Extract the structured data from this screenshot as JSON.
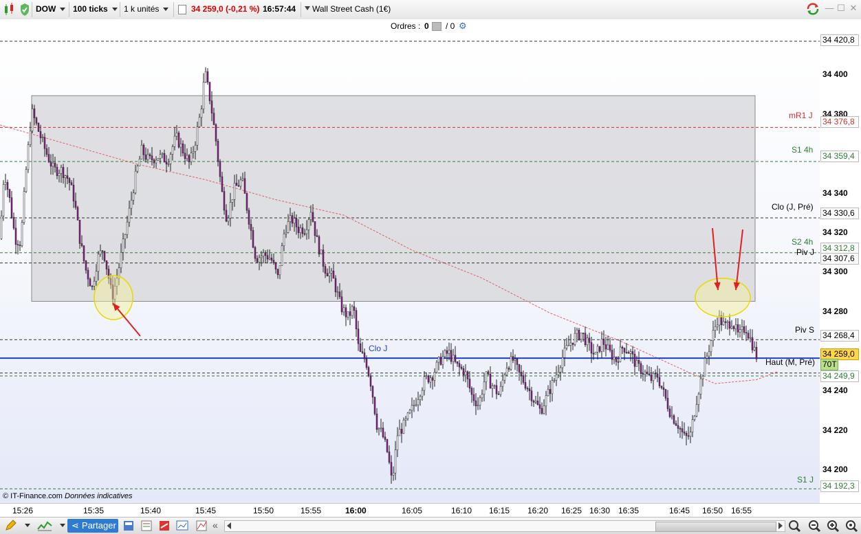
{
  "toolbar": {
    "symbol": "DOW",
    "ticks": "100 ticks",
    "units": "1 k unités",
    "price": "34 259,0",
    "change": "(-0,21 %)",
    "time": "16:57:44",
    "instrument": "Wall Street Cash (1€)"
  },
  "orders": {
    "label": "Ordres :",
    "count": "0",
    "sep": "/ 0"
  },
  "yaxis": {
    "ticks": [
      "34 400",
      "34 380",
      "34 340",
      "34 320",
      "34 300",
      "34 280",
      "34 240",
      "34 220",
      "34 200"
    ],
    "levels": [
      {
        "value": "34 420,8",
        "color": "#000000"
      },
      {
        "value": "34 376,8",
        "color": "#c83232"
      },
      {
        "value": "34 359,4",
        "color": "#2e7d32"
      },
      {
        "value": "34 330,6",
        "color": "#000000"
      },
      {
        "value": "34 312,8",
        "color": "#2e7d32"
      },
      {
        "value": "34 307,6",
        "color": "#000000"
      },
      {
        "value": "34 268,4",
        "color": "#000000"
      },
      {
        "value": "34 259,0",
        "color": "#000000"
      },
      {
        "value": "70T",
        "color": "#000000"
      },
      {
        "value": "34 249,9",
        "color": "#2e7d32"
      },
      {
        "value": "34 192,3",
        "color": "#2e7d32"
      }
    ]
  },
  "line_labels": {
    "mr1j": "mR1 J",
    "s14h": "S1 4h",
    "cloj_pre": "Clo (J, Pré)",
    "s24h": "S2 4h",
    "pivj": "Piv J",
    "pivs": "Piv S",
    "cloj": "Clo J",
    "haut": "Haut (M, Pré)",
    "s1j": "S1 J"
  },
  "xaxis": {
    "labels": [
      "15:26",
      "15:35",
      "15:40",
      "15:45",
      "15:50",
      "15:55",
      "16:00",
      "16:05",
      "16:10",
      "16:15",
      "16:20",
      "16:25",
      "16:30",
      "16:35",
      "16:45",
      "16:50",
      "16:55"
    ]
  },
  "footer": {
    "copyright": "© IT-Finance.com",
    "note": "Données indicatives"
  },
  "bottombar": {
    "share_label": "Partager"
  },
  "colors": {
    "candle_body": "#8b1a8b",
    "candle_wick": "#222222",
    "price_line": "#1f3fc9",
    "zone": "#d6d6da",
    "highlight_circle": "#f3ef9a",
    "arrow": "#e02020",
    "current_price_bg": "#ffd54a",
    "tick_count_bg": "#b6e08a"
  },
  "chart_data": {
    "type": "candlestick",
    "instrument": "Wall Street Cash (1€)",
    "interval": "100 ticks",
    "ylim": [
      34185,
      34425
    ],
    "last": 34259.0,
    "path": [
      [
        0,
        34320
      ],
      [
        6,
        34355
      ],
      [
        14,
        34340
      ],
      [
        22,
        34320
      ],
      [
        30,
        34318
      ],
      [
        38,
        34355
      ],
      [
        46,
        34385
      ],
      [
        56,
        34375
      ],
      [
        66,
        34365
      ],
      [
        78,
        34355
      ],
      [
        90,
        34355
      ],
      [
        100,
        34350
      ],
      [
        108,
        34340
      ],
      [
        116,
        34320
      ],
      [
        124,
        34305
      ],
      [
        134,
        34295
      ],
      [
        142,
        34310
      ],
      [
        150,
        34315
      ],
      [
        158,
        34300
      ],
      [
        163,
        34290
      ],
      [
        170,
        34300
      ],
      [
        178,
        34315
      ],
      [
        186,
        34330
      ],
      [
        196,
        34350
      ],
      [
        206,
        34365
      ],
      [
        216,
        34360
      ],
      [
        230,
        34362
      ],
      [
        244,
        34360
      ],
      [
        256,
        34372
      ],
      [
        266,
        34365
      ],
      [
        276,
        34358
      ],
      [
        284,
        34370
      ],
      [
        292,
        34385
      ],
      [
        298,
        34405
      ],
      [
        306,
        34390
      ],
      [
        314,
        34370
      ],
      [
        322,
        34345
      ],
      [
        330,
        34330
      ],
      [
        340,
        34345
      ],
      [
        352,
        34350
      ],
      [
        362,
        34330
      ],
      [
        372,
        34310
      ],
      [
        384,
        34312
      ],
      [
        394,
        34310
      ],
      [
        404,
        34300
      ],
      [
        414,
        34325
      ],
      [
        424,
        34330
      ],
      [
        434,
        34325
      ],
      [
        444,
        34325
      ],
      [
        452,
        34335
      ],
      [
        460,
        34320
      ],
      [
        472,
        34305
      ],
      [
        484,
        34300
      ],
      [
        496,
        34285
      ],
      [
        506,
        34280
      ],
      [
        514,
        34285
      ],
      [
        522,
        34262
      ],
      [
        532,
        34258
      ],
      [
        540,
        34245
      ],
      [
        548,
        34225
      ],
      [
        556,
        34220
      ],
      [
        564,
        34210
      ],
      [
        570,
        34195
      ],
      [
        578,
        34220
      ],
      [
        588,
        34225
      ],
      [
        598,
        34232
      ],
      [
        608,
        34240
      ],
      [
        618,
        34248
      ],
      [
        628,
        34250
      ],
      [
        640,
        34258
      ],
      [
        652,
        34262
      ],
      [
        664,
        34255
      ],
      [
        676,
        34252
      ],
      [
        686,
        34240
      ],
      [
        696,
        34235
      ],
      [
        706,
        34250
      ],
      [
        716,
        34245
      ],
      [
        726,
        34240
      ],
      [
        736,
        34255
      ],
      [
        746,
        34258
      ],
      [
        756,
        34250
      ],
      [
        766,
        34245
      ],
      [
        776,
        34238
      ],
      [
        786,
        34232
      ],
      [
        796,
        34240
      ],
      [
        806,
        34248
      ],
      [
        816,
        34258
      ],
      [
        826,
        34265
      ],
      [
        836,
        34270
      ],
      [
        846,
        34272
      ],
      [
        856,
        34265
      ],
      [
        866,
        34260
      ],
      [
        876,
        34268
      ],
      [
        886,
        34262
      ],
      [
        896,
        34258
      ],
      [
        906,
        34265
      ],
      [
        916,
        34262
      ],
      [
        926,
        34255
      ],
      [
        936,
        34252
      ],
      [
        946,
        34248
      ],
      [
        956,
        34250
      ],
      [
        966,
        34240
      ],
      [
        976,
        34230
      ],
      [
        986,
        34225
      ],
      [
        996,
        34218
      ],
      [
        1004,
        34220
      ],
      [
        1014,
        34240
      ],
      [
        1024,
        34255
      ],
      [
        1034,
        34268
      ],
      [
        1044,
        34280
      ],
      [
        1054,
        34275
      ],
      [
        1064,
        34278
      ],
      [
        1074,
        34270
      ],
      [
        1084,
        34275
      ],
      [
        1092,
        34268
      ],
      [
        1100,
        34260
      ]
    ],
    "moving_average": [
      [
        0,
        34378
      ],
      [
        100,
        34368
      ],
      [
        200,
        34358
      ],
      [
        300,
        34350
      ],
      [
        400,
        34340
      ],
      [
        500,
        34332
      ],
      [
        600,
        34314
      ],
      [
        700,
        34300
      ],
      [
        800,
        34282
      ],
      [
        900,
        34268
      ],
      [
        1000,
        34252
      ],
      [
        1040,
        34246
      ],
      [
        1100,
        34248
      ],
      [
        1130,
        34252
      ]
    ],
    "zone": {
      "x0": 46,
      "x1": 1098,
      "y0": 34288,
      "y1": 34393
    },
    "levels": [
      {
        "name": "",
        "value": 34420.8
      },
      {
        "name": "mR1 J",
        "value": 34376.8
      },
      {
        "name": "S1 4h",
        "value": 34359.4
      },
      {
        "name": "Clo (J, Pré)",
        "value": 34330.6
      },
      {
        "name": "S2 4h",
        "value": 34312.8
      },
      {
        "name": "Piv J",
        "value": 34307.6
      },
      {
        "name": "Piv S",
        "value": 34268.4
      },
      {
        "name": "Clo J",
        "value": 34259.0
      },
      {
        "name": "Haut (M, Pré)",
        "value": 34251.4
      },
      {
        "name": "S1 J",
        "value": 34192.3
      }
    ]
  }
}
